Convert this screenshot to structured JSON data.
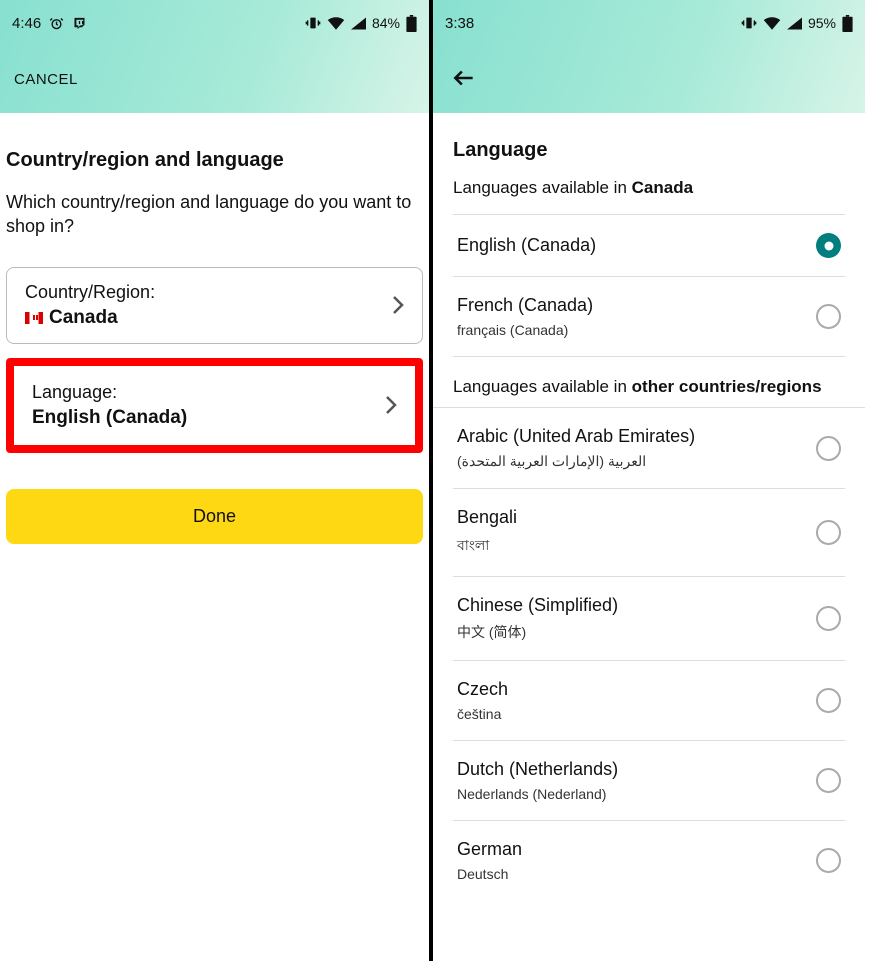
{
  "left": {
    "status": {
      "time": "4:46",
      "battery_pct": "84%"
    },
    "nav": {
      "cancel": "CANCEL"
    },
    "title": "Country/region and language",
    "question": "Which country/region and language do you want to shop in?",
    "country_card": {
      "label": "Country/Region:",
      "value": "Canada"
    },
    "language_card": {
      "label": "Language:",
      "value": "English (Canada)"
    },
    "done": "Done"
  },
  "right": {
    "status": {
      "time": "3:38",
      "battery_pct": "95%"
    },
    "title": "Language",
    "avail_prefix": "Languages available in ",
    "avail_country": "Canada",
    "other_prefix": "Languages available in ",
    "other_suffix": "other countries/regions",
    "primary_langs": [
      {
        "name": "English (Canada)",
        "native": "",
        "selected": true
      },
      {
        "name": "French (Canada)",
        "native": "français (Canada)",
        "selected": false
      }
    ],
    "other_langs": [
      {
        "name": "Arabic (United Arab Emirates)",
        "native": "العربية (الإمارات العربية المتحدة)"
      },
      {
        "name": "Bengali",
        "native": "বাংলা"
      },
      {
        "name": "Chinese (Simplified)",
        "native": "中文 (简体)"
      },
      {
        "name": "Czech",
        "native": "čeština"
      },
      {
        "name": "Dutch (Netherlands)",
        "native": "Nederlands (Nederland)"
      },
      {
        "name": "German",
        "native": "Deutsch"
      }
    ]
  }
}
